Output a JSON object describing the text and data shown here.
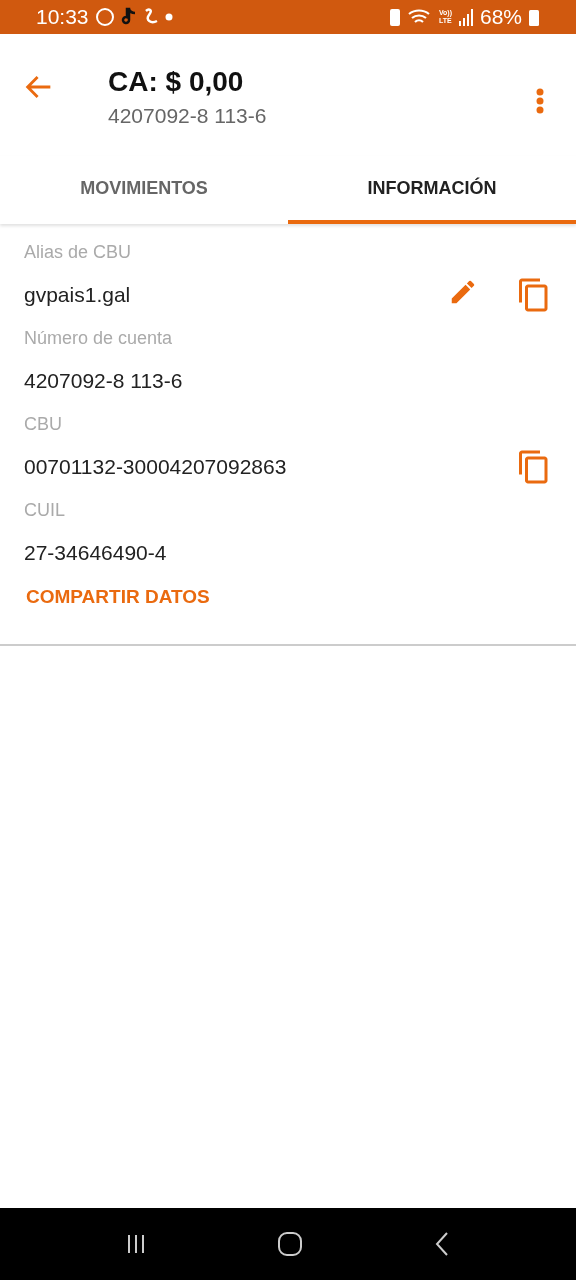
{
  "status_bar": {
    "time": "10:33",
    "volte_top": "Vo))",
    "volte_bottom": "LTE",
    "battery": "68%"
  },
  "header": {
    "title": "CA: $ 0,00",
    "subtitle": "4207092-8 113-6"
  },
  "tabs": [
    {
      "label": "MOVIMIENTOS",
      "selected": false
    },
    {
      "label": "INFORMACIÓN",
      "selected": true
    }
  ],
  "fields": [
    {
      "label": "Alias de CBU",
      "value": "gvpais1.gal",
      "actions": [
        {
          "kind": "edit"
        },
        {
          "kind": "copy"
        }
      ]
    },
    {
      "label": "Número de cuenta",
      "value": "4207092-8 113-6"
    },
    {
      "label": "CBU",
      "value": "00701132-30004207092863",
      "actions": [
        {
          "kind": "copy"
        }
      ]
    },
    {
      "label": "CUIL",
      "value": "27-34646490-4"
    }
  ],
  "share_button": "COMPARTIR DATOS"
}
